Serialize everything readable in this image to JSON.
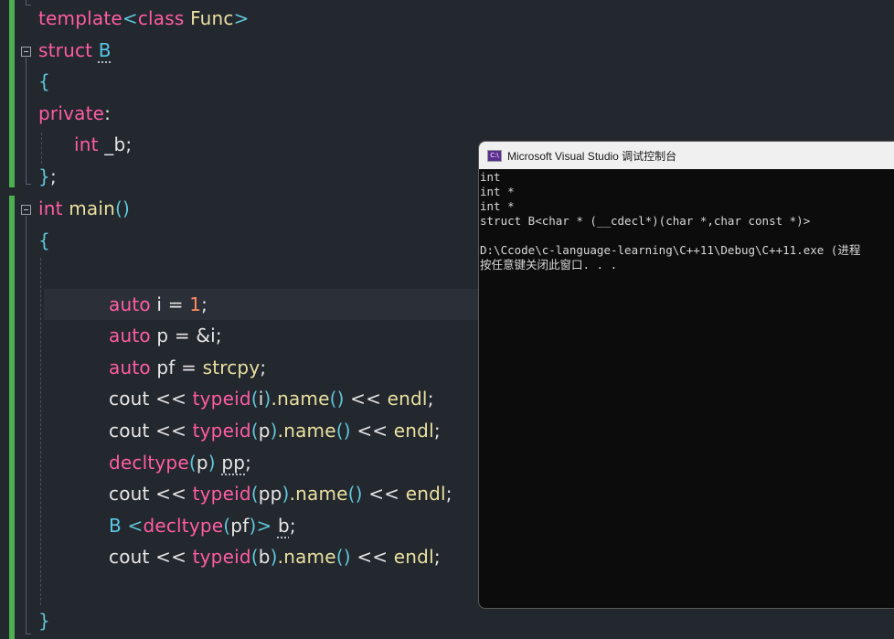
{
  "code": {
    "l1": {
      "kw": "template",
      "lt": "<",
      "kw2": "class",
      "name": " Func",
      "gt": ">"
    },
    "l2": {
      "kw": "struct",
      "name": "B"
    },
    "l3": {
      "brace": "{"
    },
    "l4": {
      "kw": "private",
      "colon": ":"
    },
    "l5": {
      "ty": "int",
      "name": " _b",
      "semi": ";"
    },
    "l6": {
      "brace": "}",
      "semi": ";"
    },
    "l7": {
      "ty": "int",
      "fn": " main",
      "paren": "()"
    },
    "l8": {
      "brace": "{"
    },
    "l10": {
      "kw": "auto",
      "id": " i ",
      "op": "= ",
      "num": "1",
      "semi": ";"
    },
    "l11": {
      "kw": "auto",
      "id": " p ",
      "op": "= &",
      "id2": "i",
      "semi": ";"
    },
    "l12": {
      "kw": "auto",
      "id": " pf ",
      "op": "= ",
      "fn": "strcpy",
      "semi": ";"
    },
    "l13": {
      "a": "cout << ",
      "b": "typeid",
      "c": "(",
      "d": "i",
      "e": ")",
      "f": ".name",
      "g": "()",
      "h": " << ",
      "i": "endl",
      "j": ";"
    },
    "l14": {
      "a": "cout << ",
      "b": "typeid",
      "c": "(",
      "d": "p",
      "e": ")",
      "f": ".name",
      "g": "()",
      "h": " << ",
      "i": "endl",
      "j": ";"
    },
    "l15": {
      "kw": "decltype",
      "lp": "(",
      "id": "p",
      "rp": ")",
      "sp": " ",
      "name": "pp",
      "semi": ";"
    },
    "l16": {
      "a": "cout << ",
      "b": "typeid",
      "c": "(",
      "d": "pp",
      "e": ")",
      "f": ".name",
      "g": "()",
      "h": " << ",
      "i": "endl",
      "j": ";"
    },
    "l17": {
      "ty": "B",
      "lt": " <",
      "kw": "decltype",
      "lp": "(",
      "id": "pf",
      "rp": ")",
      "gt": ">",
      "sp": " ",
      "name": "b",
      "semi": ";"
    },
    "l18": {
      "a": "cout << ",
      "b": "typeid",
      "c": "(",
      "d": "b",
      "e": ")",
      "f": ".name",
      "g": "()",
      "h": " << ",
      "i": "endl",
      "j": ";"
    },
    "l20": {
      "brace": "}"
    }
  },
  "console": {
    "title": "Microsoft Visual Studio 调试控制台",
    "icon_text": "C:\\",
    "lines": [
      "int",
      "int *",
      "int *",
      "struct B<char * (__cdecl*)(char *,char const *)>",
      "",
      "D:\\Ccode\\c-language-learning\\C++11\\Debug\\C++11.exe (进程",
      "按任意键关闭此窗口. . ."
    ]
  },
  "colors": {
    "keyword": "#ff5da2",
    "type": "#58c8e8",
    "function": "#e9e0a0",
    "bracket": "#5fc6d9",
    "number": "#ff8a65",
    "gutter": "#4caf50"
  }
}
